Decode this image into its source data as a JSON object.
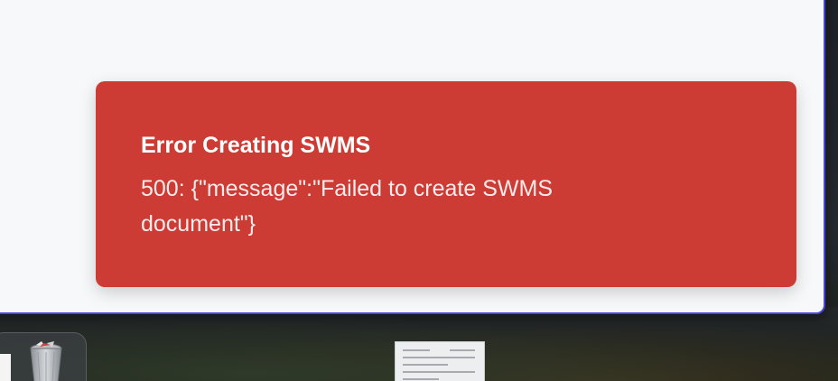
{
  "toast": {
    "title": "Error Creating SWMS",
    "message": "500: {\"message\":\"Failed to create SWMS document\"}",
    "background_color": "#cc3c35",
    "text_color": "#ffffff"
  },
  "window": {
    "border_color": "#4b47d6",
    "background_color": "#f7f8fa"
  },
  "dock": {
    "items": [
      {
        "icon": "document-icon"
      },
      {
        "icon": "trash-icon"
      }
    ]
  },
  "desktop": {
    "items": [
      {
        "icon": "document-thumbnail-icon"
      }
    ]
  }
}
